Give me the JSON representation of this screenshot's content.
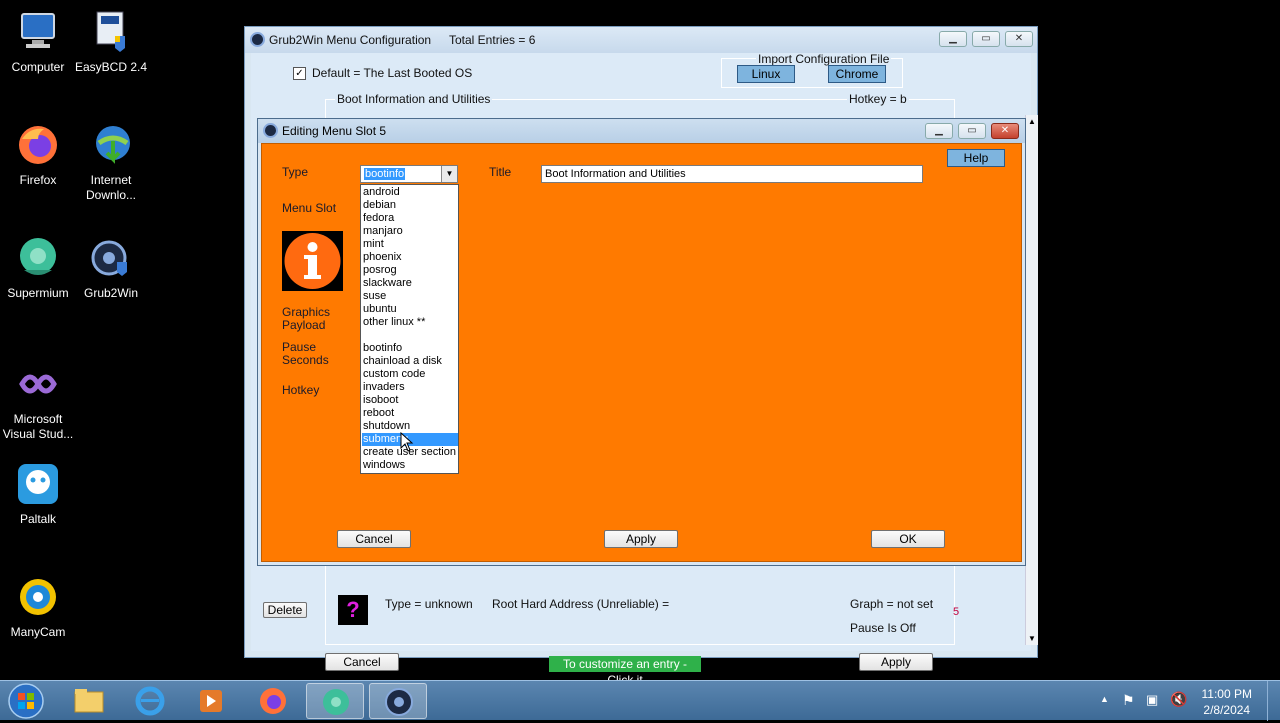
{
  "desktop": {
    "icons": [
      {
        "label": "Computer"
      },
      {
        "label": "EasyBCD 2.4"
      },
      {
        "label": "Firefox"
      },
      {
        "label": "Internet Downlo..."
      },
      {
        "label": "Supermium"
      },
      {
        "label": "Grub2Win"
      },
      {
        "label": "Microsoft Visual Stud..."
      },
      {
        "label": "Paltalk"
      },
      {
        "label": "ManyCam"
      }
    ]
  },
  "main_window": {
    "title": "Grub2Win Menu Configuration",
    "total_entries": "Total Entries = 6",
    "default_checkbox": {
      "label": "Default = The Last Booted OS",
      "checked": true
    },
    "import_group": {
      "title": "Import Configuration File",
      "linux": "Linux",
      "chrome": "Chrome"
    },
    "entry_group": {
      "title": "Boot Information and Utilities",
      "hotkey": "Hotkey = b"
    },
    "bottom_entry": {
      "delete": "Delete",
      "type": "Type = unknown",
      "root": "Root Hard Address (Unreliable) =",
      "graph": "Graph = not set",
      "pause": "Pause Is Off",
      "slot_num": "5"
    },
    "cancel": "Cancel",
    "hint": "To customize an entry - Click it",
    "apply": "Apply"
  },
  "dialog": {
    "title": "Editing Menu Slot 5",
    "help": "Help",
    "labels": {
      "type": "Type",
      "title": "Title",
      "menu_slot": "Menu Slot",
      "graphics": "Graphics",
      "payload": "Payload",
      "pause": "Pause",
      "seconds": "Seconds",
      "hotkey": "Hotkey"
    },
    "type_value": "bootinfo",
    "title_value": "Boot Information and Utilities",
    "dropdown_items": [
      "android",
      "debian",
      "fedora",
      "manjaro",
      "mint",
      "phoenix",
      "posrog",
      "slackware",
      "suse",
      "ubuntu",
      "other linux **",
      "",
      "bootinfo",
      "chainload a disk",
      "custom code",
      "invaders",
      "isoboot",
      "reboot",
      "shutdown",
      "submenu",
      "create user section",
      "windows"
    ],
    "selected_index": 19,
    "cancel": "Cancel",
    "apply": "Apply",
    "ok": "OK"
  },
  "taskbar": {
    "time": "11:00 PM",
    "date": "2/8/2024"
  },
  "colors": {
    "dialog_bg": "#ff7a00",
    "accent": "#3399ff",
    "hint_bg": "#2fb14a"
  }
}
